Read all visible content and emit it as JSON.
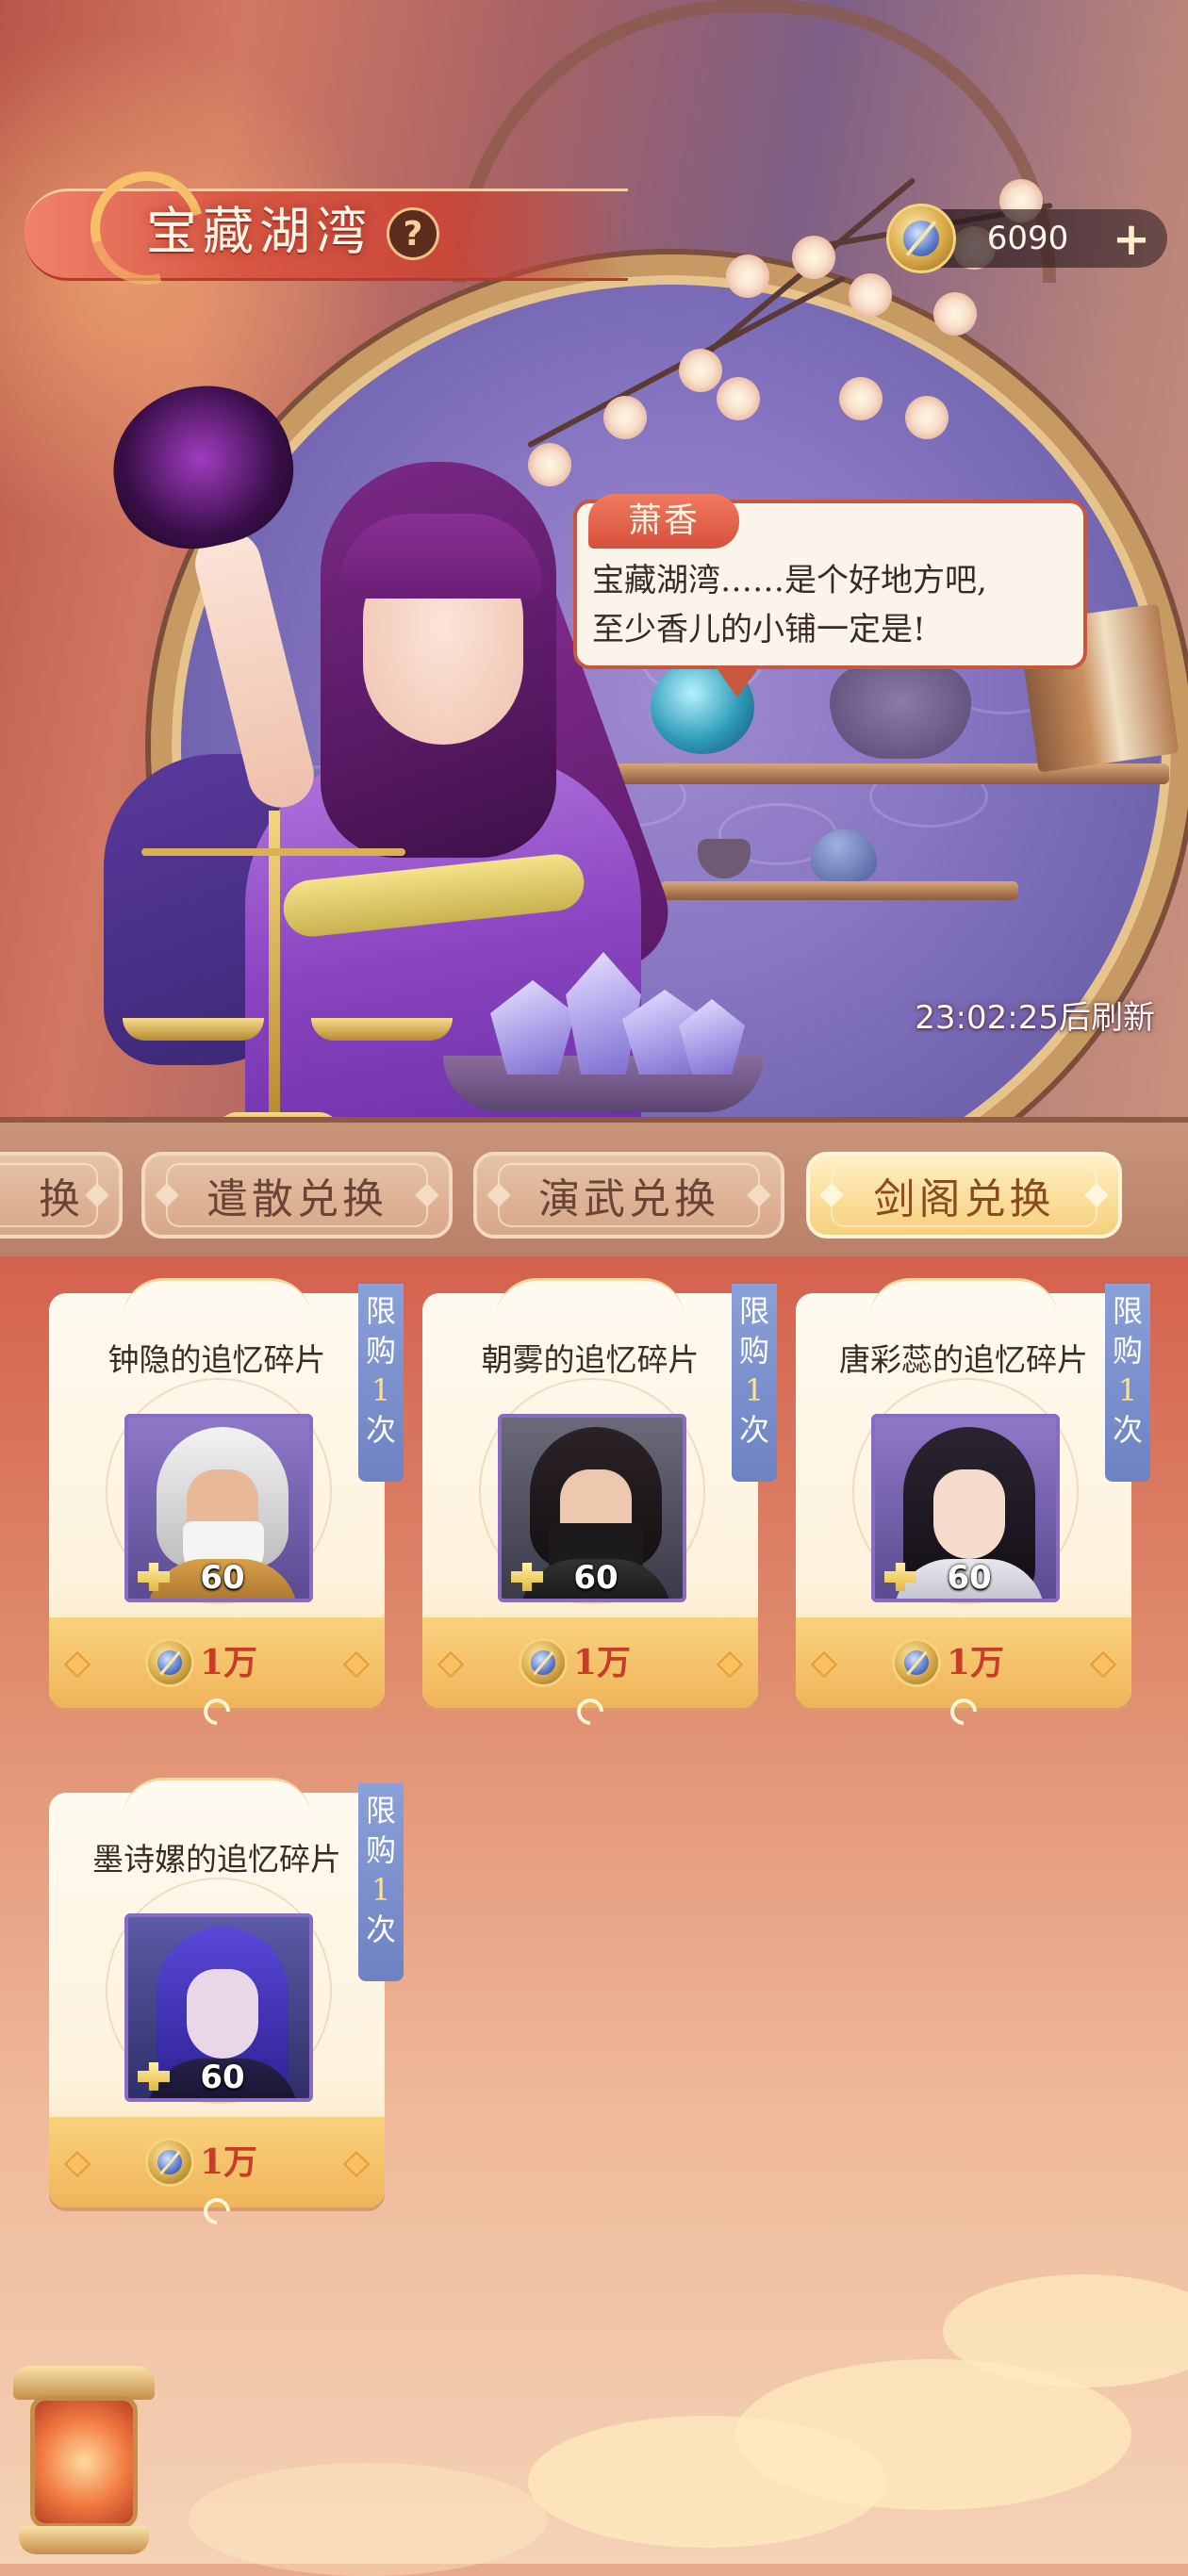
{
  "header": {
    "title": "宝藏湖湾",
    "help_label": "?"
  },
  "currency": {
    "amount": "6090",
    "add_label": "+"
  },
  "dialogue": {
    "speaker": "萧香",
    "text": "宝藏湖湾……是个好地方吧,\n至少香儿的小铺一定是!"
  },
  "refresh": {
    "text": "23:02:25后刷新"
  },
  "tabs": [
    {
      "label": "换",
      "active": false
    },
    {
      "label": "遣散兑换",
      "active": false
    },
    {
      "label": "演武兑换",
      "active": false
    },
    {
      "label": "剑阁兑换",
      "active": true
    }
  ],
  "items": [
    {
      "name": "钟隐的追忆碎片",
      "limit": [
        "限",
        "购",
        "1",
        "次"
      ],
      "quantity": "60",
      "price": "1万"
    },
    {
      "name": "朝雾的追忆碎片",
      "limit": [
        "限",
        "购",
        "1",
        "次"
      ],
      "quantity": "60",
      "price": "1万"
    },
    {
      "name": "唐彩蕊的追忆碎片",
      "limit": [
        "限",
        "购",
        "1",
        "次"
      ],
      "quantity": "60",
      "price": "1万"
    },
    {
      "name": "墨诗嫘的追忆碎片",
      "limit": [
        "限",
        "购",
        "1",
        "次"
      ],
      "quantity": "60",
      "price": "1万"
    }
  ],
  "colors": {
    "accent_red": "#c8473a",
    "tab_active": "#f6cf7a",
    "price_text": "#c83d28",
    "limit_badge": "#7b90cd"
  },
  "icons": {
    "currency": "sword-coin-icon",
    "help": "question-icon",
    "fragment": "puzzle-fragment-icon"
  }
}
